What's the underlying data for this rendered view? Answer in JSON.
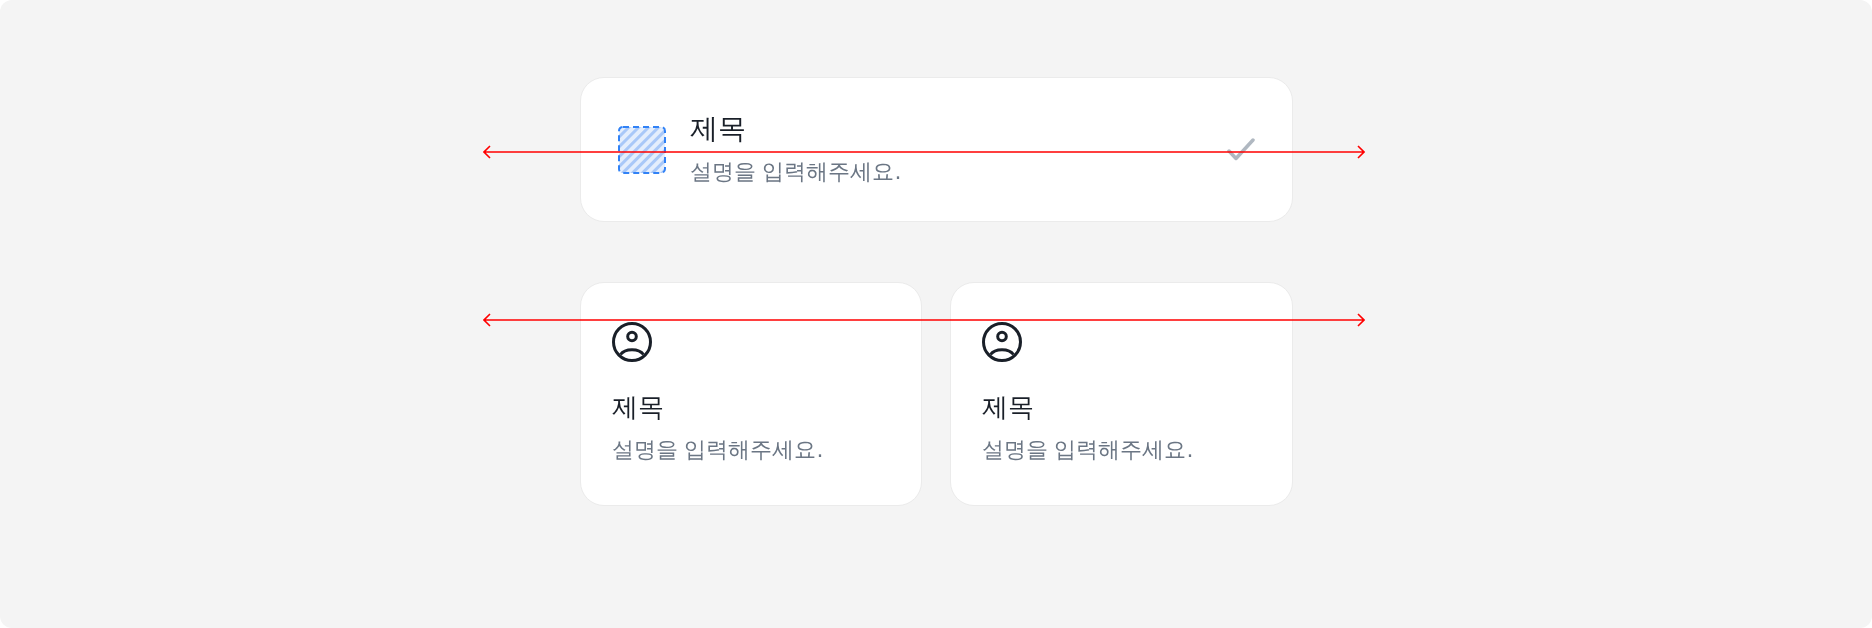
{
  "sections": [
    {
      "kind": "list",
      "measure_line": true,
      "items": [
        {
          "kind": "row",
          "title": "제목",
          "description": "설명을 입력해주세요.",
          "selected": false
        }
      ]
    },
    {
      "kind": "grid",
      "measure_line": true,
      "items": [
        {
          "kind": "tile",
          "title": "제목",
          "description": "설명을 입력해주세요."
        },
        {
          "kind": "tile",
          "title": "제목",
          "description": "설명을 입력해주세요."
        }
      ]
    }
  ]
}
